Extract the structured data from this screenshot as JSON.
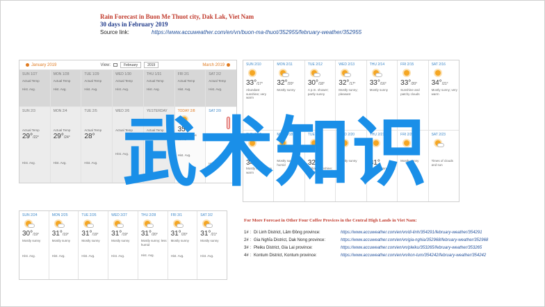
{
  "header": {
    "title": "Rain Forecast in Buon Me Thuot city, Dak Lak, Viet Nam",
    "subtitle": "30 days in February 2019",
    "source_label": "Source link:",
    "source_url": "https://www.accuweather.com/en/vn/buon-ma-thuot/352955/february-weather/352955"
  },
  "panel_a": {
    "nav": {
      "prev": "January 2019",
      "view_label": "View:",
      "month": "February",
      "year": "2019",
      "next": "March 2019"
    },
    "row1": [
      {
        "day": "SUN 1/27",
        "text": "Actual Temp",
        "hist": "Hist. Avg.",
        "past": true
      },
      {
        "day": "MON 1/28",
        "text": "Actual Temp",
        "hist": "Hist. Avg.",
        "past": true
      },
      {
        "day": "TUE 1/29",
        "text": "Actual Temp",
        "hist": "Hist. Avg.",
        "past": true
      },
      {
        "day": "WED 1/30",
        "text": "Actual Temp",
        "hist": "Hist. Avg.",
        "past": true
      },
      {
        "day": "THU 1/31",
        "text": "Actual Temp",
        "hist": "Hist. Avg.",
        "past": true
      },
      {
        "day": "FRI 2/1",
        "text": "Actual Temp",
        "hist": "Hist. Avg.",
        "past": true
      },
      {
        "day": "SAT 2/2",
        "text": "Actual Temp",
        "hist": "Hist. Avg.",
        "past": true
      }
    ],
    "row2": [
      {
        "day": "SUN 2/3",
        "temp": "29°",
        "lo": "/22°",
        "text": "Actual Temp",
        "hist": "Hist. Avg."
      },
      {
        "day": "MON 2/4",
        "temp": "29°",
        "lo": "/24°",
        "text": "Actual Temp",
        "hist": "Hist. Avg."
      },
      {
        "day": "TUE 2/5",
        "temp": "28°",
        "lo": "",
        "text": "Actual Temp",
        "hist": "Hist. Avg."
      },
      {
        "day": "WED 2/6",
        "temp": "",
        "lo": "",
        "text": "Actual Temp",
        "hist": "Hist. Avg."
      },
      {
        "day": "YESTERDAY",
        "temp": "",
        "lo": "",
        "text": "Actual Temp",
        "hist": "Hist. Avg."
      },
      {
        "day": "TODAY 2/8",
        "temp": "35°",
        "lo": "",
        "text": "Sunny, not as humid",
        "hist": "Hist. Avg."
      },
      {
        "day": "SAT 2/9",
        "temp": "",
        "lo": "",
        "text": "",
        "hist": "Hist. Avg."
      }
    ]
  },
  "panel_b": {
    "row1": [
      {
        "day": "SUN 2/10",
        "temp": "33°",
        "lo": "/17°",
        "text": "Abundant sunshine; very warm"
      },
      {
        "day": "MON 2/11",
        "temp": "32°",
        "lo": "/20°",
        "text": "Mostly sunny"
      },
      {
        "day": "TUE 2/12",
        "temp": "30°",
        "lo": "/18°",
        "text": "A p.m. shower; partly sunny"
      },
      {
        "day": "WED 2/13",
        "temp": "32°",
        "lo": "/17°",
        "text": "Mostly sunny; pleasant"
      },
      {
        "day": "THU 2/14",
        "temp": "33°",
        "lo": "/16°",
        "text": "Mostly sunny"
      },
      {
        "day": "FRI 2/15",
        "temp": "33°",
        "lo": "/20°",
        "text": "Sunshine and patchy clouds"
      },
      {
        "day": "SAT 2/16",
        "temp": "34°",
        "lo": "/21°",
        "text": "Mostly sunny; very warm"
      }
    ],
    "row2": [
      {
        "day": "SUN 2/17",
        "temp": "34°",
        "lo": "",
        "text": "Mostly sunny; very warm"
      },
      {
        "day": "MON 2/18",
        "temp": "",
        "lo": "",
        "text": "Mostly sunny; less humid"
      },
      {
        "day": "TUE 2/19",
        "temp": "32°",
        "lo": "",
        "text": "Brilliant sunshine; less humid"
      },
      {
        "day": "WED 2/20",
        "temp": "",
        "lo": "",
        "text": "Mostly sunny"
      },
      {
        "day": "THU 2/21",
        "temp": "31°",
        "lo": "",
        "text": "Mostly sunny; less humid"
      },
      {
        "day": "FRI 2/22",
        "temp": "",
        "lo": "",
        "text": "Mostly sunny"
      },
      {
        "day": "SAT 2/23",
        "temp": "",
        "lo": "",
        "text": "Times of clouds and sun"
      }
    ]
  },
  "panel_c": {
    "row1": [
      {
        "day": "SUN 2/24",
        "temp": "30°",
        "lo": "/19°",
        "text": "Mostly sunny",
        "hist": "Hist. Avg."
      },
      {
        "day": "MON 2/25",
        "temp": "31°",
        "lo": "/19°",
        "text": "Mostly sunny",
        "hist": "Hist. Avg."
      },
      {
        "day": "TUE 2/26",
        "temp": "31°",
        "lo": "/19°",
        "text": "Mostly sunny",
        "hist": "Hist. Avg."
      },
      {
        "day": "WED 2/27",
        "temp": "31°",
        "lo": "/19°",
        "text": "Mostly sunny",
        "hist": "Hist. Avg."
      },
      {
        "day": "THU 2/28",
        "temp": "31°",
        "lo": "/20°",
        "text": "Mostly sunny; less humid",
        "hist": "Hist. Avg."
      },
      {
        "day": "FRI 3/1",
        "temp": "31°",
        "lo": "/20°",
        "text": "Mostly sunny",
        "hist": "Hist. Avg."
      },
      {
        "day": "SAT 3/2",
        "temp": "31°",
        "lo": "/21°",
        "text": "Mostly sunny",
        "hist": "Hist. Avg."
      }
    ]
  },
  "more": {
    "title": "For More Forecast in Other Four Coffee Provices in the Central High Lands in Viet Nam:",
    "items": [
      {
        "num": "1# :",
        "place": "Di Linh District, Lâm Đồng province:",
        "url": "https://www.accuweather.com/en/vn/di-linh/354291/february-weather/354291"
      },
      {
        "num": "2# :",
        "place": "Gia Nghĩa District, Dak Nong province:",
        "url": "https://www.accuweather.com/en/vn/gia-nghia/352968/february-weather/352968"
      },
      {
        "num": "3# :",
        "place": "Pleiku District, Gia Lai province:",
        "url": "https://www.accuweather.com/en/vn/pleiku/353265/february-weather/353265"
      },
      {
        "num": "4# :",
        "place": "Kontum District, Kontum province:",
        "url": "https://www.accuweather.com/en/vn/kon-tum/354242/february-weather/354242"
      }
    ]
  },
  "watermark": "武术知识",
  "colors": {
    "title_red": "#c0392b",
    "title_blue": "#1f3a8a",
    "link_blue": "#1f4e9a",
    "day_blue": "#3a86c8",
    "sun": "#f5a623",
    "watermark": "#1a8fe8"
  }
}
